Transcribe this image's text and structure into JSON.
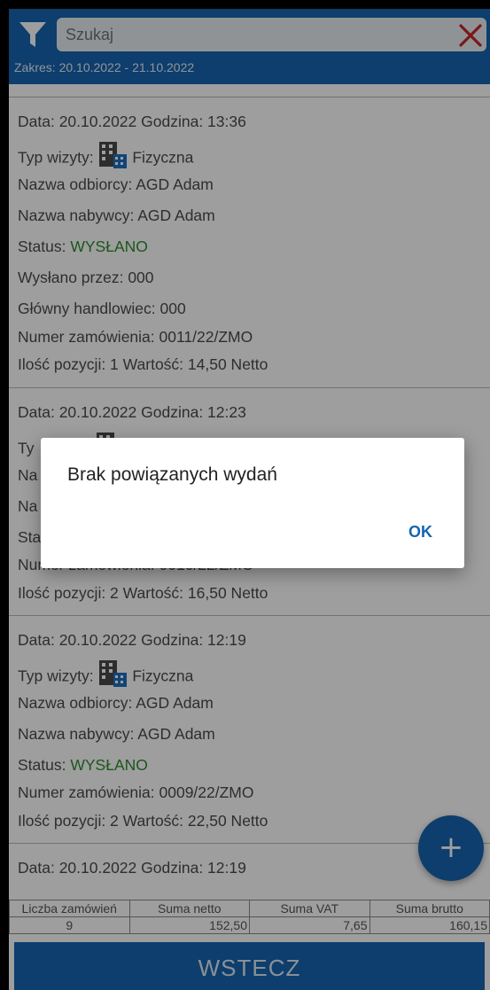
{
  "search": {
    "placeholder": "Szukaj"
  },
  "range_label": "Zakres: 20.10.2022 - 21.10.2022",
  "orders": [
    {
      "date_line": "Data:  20.10.2022  Godzina:  13:36",
      "visit_label": "Typ wizyty:",
      "visit_value": "Fizyczna",
      "recipient": "Nazwa odbiorcy: AGD Adam",
      "buyer": "Nazwa nabywcy: AGD Adam",
      "status_label": "Status:",
      "status_value": "WYSŁANO",
      "sent_by": "Wysłano przez: 000",
      "main_rep": "Główny handlowiec: 000",
      "order_no": "Numer zamówienia: 0011/22/ZMO",
      "items": "Ilość pozycji: 1  Wartość:  14,50 Netto"
    },
    {
      "date_line": "Data:  20.10.2022  Godzina:  12:23",
      "line2": "Ty",
      "line3": "Na",
      "line4": "Na",
      "line5": "Sta",
      "order_no": "Numer zamówienia: 0010/22/ZMO",
      "items": "Ilość pozycji: 2  Wartość:  16,50 Netto"
    },
    {
      "date_line": "Data:  20.10.2022  Godzina:  12:19",
      "visit_label": "Typ wizyty:",
      "visit_value": "Fizyczna",
      "recipient": "Nazwa odbiorcy: AGD Adam",
      "buyer": "Nazwa nabywcy: AGD Adam",
      "status_label": "Status:",
      "status_value": "WYSŁANO",
      "order_no": "Numer zamówienia: 0009/22/ZMO",
      "items": "Ilość pozycji: 2  Wartość:  22,50 Netto"
    },
    {
      "date_line": "Data:  20.10.2022  Godzina:  12:19"
    }
  ],
  "fab_label": "+",
  "summary": {
    "headers": [
      "Liczba zamówień",
      "Suma netto",
      "Suma VAT",
      "Suma brutto"
    ],
    "values": [
      "9",
      "152,50",
      "7,65",
      "160,15"
    ]
  },
  "back_label": "WSTECZ",
  "dialog": {
    "message": "Brak powiązanych wydań",
    "ok": "OK"
  },
  "colors": {
    "primary": "#1565b0",
    "status_green": "#2e8b2e",
    "close_red": "#c62828"
  }
}
